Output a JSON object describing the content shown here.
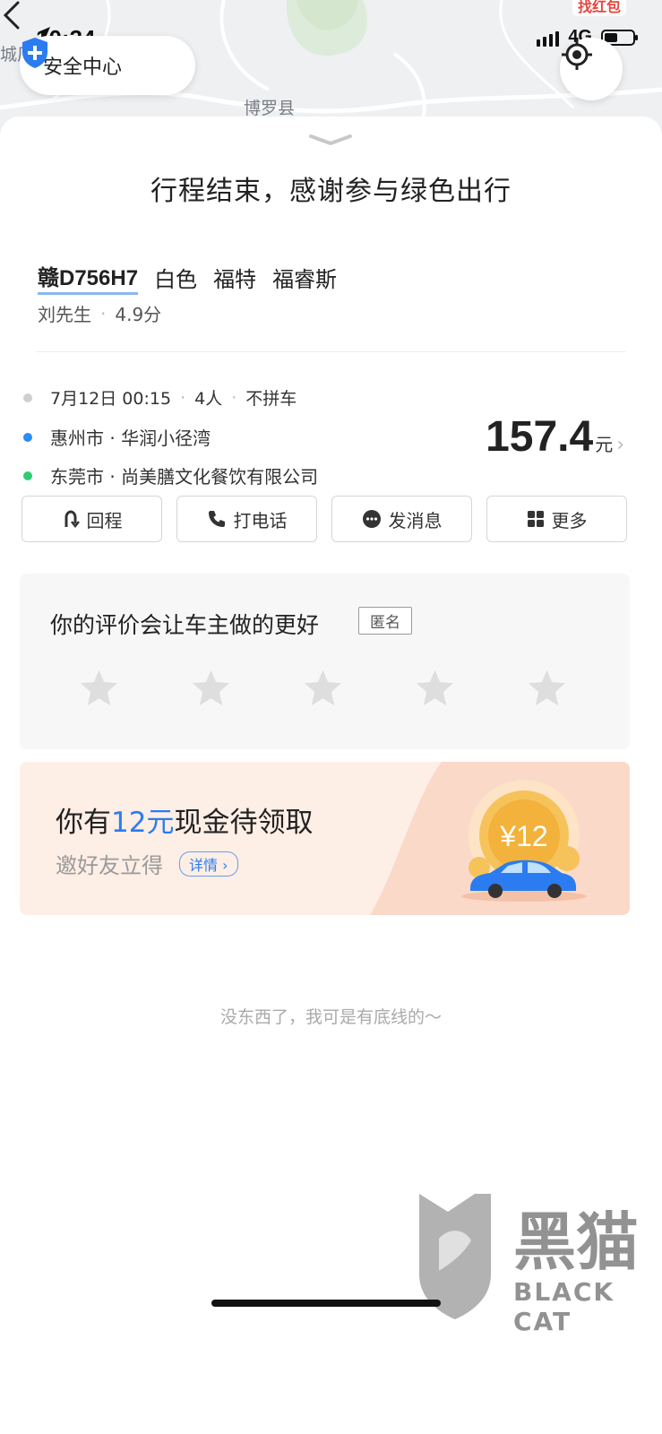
{
  "status_bar": {
    "time": "10:34",
    "network": "4G",
    "top_badge": "找红包"
  },
  "map": {
    "labels": [
      "城厂",
      "博罗县"
    ]
  },
  "safety": {
    "label": "安全中心",
    "icon": "shield-plus-icon"
  },
  "sheet": {
    "title": "行程结束，感谢参与绿色出行",
    "car": {
      "plate": "赣D756H7",
      "color": "白色",
      "brand": "福特",
      "model": "福睿斯"
    },
    "driver": {
      "name": "刘先生",
      "rating": "4.9分"
    },
    "trip": {
      "date_time": "7月12日 00:15",
      "passengers": "4人",
      "carpool": "不拼车",
      "origin": "惠州市 · 华润小径湾",
      "destination": "东莞市 · 尚美膳文化餐饮有限公司",
      "price": "157.4",
      "price_unit": "元"
    },
    "actions": [
      {
        "label": "回程",
        "icon": "return-trip-icon"
      },
      {
        "label": "打电话",
        "icon": "phone-icon"
      },
      {
        "label": "发消息",
        "icon": "message-icon"
      },
      {
        "label": "更多",
        "icon": "grid-more-icon"
      }
    ]
  },
  "rating": {
    "title": "你的评价会让车主做的更好",
    "anonymous_tag": "匿名",
    "stars": 0,
    "max_stars": 5
  },
  "promo": {
    "title_prefix": "你有",
    "title_amount": "12元",
    "title_suffix": "现金待领取",
    "subtitle": "邀好友立得",
    "detail_label": "详情",
    "coin_text": "¥12"
  },
  "footer_note": "没东西了，我可是有底线的～",
  "watermark": {
    "cn": "黑猫",
    "en": "BLACK CAT"
  },
  "colors": {
    "accent_blue": "#2b7cf0",
    "origin_dot": "#2a8df2",
    "destination_dot": "#2ecc71",
    "promo_bg": "#fdeee6"
  }
}
